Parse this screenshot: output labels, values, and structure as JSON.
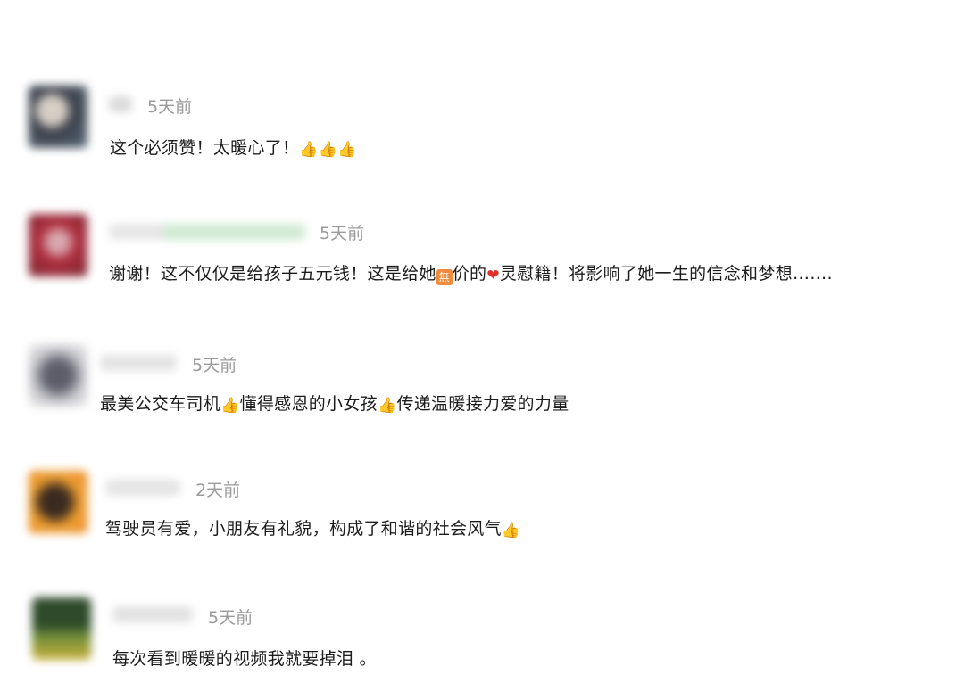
{
  "comments": [
    {
      "time": "5天前",
      "parts": [
        {
          "t": "text",
          "v": "这个必须赞！太暖心了！"
        },
        {
          "t": "emoji",
          "v": "👍"
        },
        {
          "t": "emoji",
          "v": "👍"
        },
        {
          "t": "emoji",
          "v": "👍"
        }
      ],
      "avatar_colors": [
        "#3a3f4a",
        "#d6cfc5",
        "#5b6b7a"
      ],
      "name_colors": [
        "#d9d9d9",
        "#e5e5e5"
      ]
    },
    {
      "time": "5天前",
      "parts": [
        {
          "t": "text",
          "v": "谢谢！这不仅仅是给孩子五元钱！这是给她"
        },
        {
          "t": "badge",
          "v": "無"
        },
        {
          "t": "text",
          "v": "价的"
        },
        {
          "t": "heart",
          "v": "❤"
        },
        {
          "t": "text",
          "v": "灵慰籍！将影响了她一生的信念和梦想……."
        }
      ],
      "avatar_colors": [
        "#b03040",
        "#7a2430",
        "#d9a9b0"
      ],
      "name_colors": [
        "#e6e6e6",
        "#cfead3"
      ]
    },
    {
      "time": "5天前",
      "parts": [
        {
          "t": "text",
          "v": "最美公交车司机"
        },
        {
          "t": "emoji",
          "v": "👍"
        },
        {
          "t": "text",
          "v": "懂得感恩的小女孩"
        },
        {
          "t": "emoji",
          "v": "👍"
        },
        {
          "t": "text",
          "v": "传递温暖接力爱的力量"
        }
      ],
      "avatar_colors": [
        "#c9c9cf",
        "#5d5d6a",
        "#eeeeee"
      ],
      "name_colors": [
        "#e3e3e3",
        "#ebebeb"
      ]
    },
    {
      "time": "2天前",
      "parts": [
        {
          "t": "text",
          "v": "驾驶员有爱，小朋友有礼貌，构成了和谐的社会风气"
        },
        {
          "t": "emoji",
          "v": "👍"
        }
      ],
      "avatar_colors": [
        "#f0a030",
        "#3a2a20",
        "#e88a2a"
      ],
      "name_colors": [
        "#e4e4e4",
        "#ececec"
      ]
    },
    {
      "time": "5天前",
      "parts": [
        {
          "t": "text",
          "v": "每次看到暖暖的视频我就要掉泪 。"
        }
      ],
      "avatar_colors": [
        "#2e4a2a",
        "#c9b03a",
        "#6a8a3a"
      ],
      "name_colors": [
        "#e1e1e1",
        "#eaeaea"
      ]
    }
  ]
}
